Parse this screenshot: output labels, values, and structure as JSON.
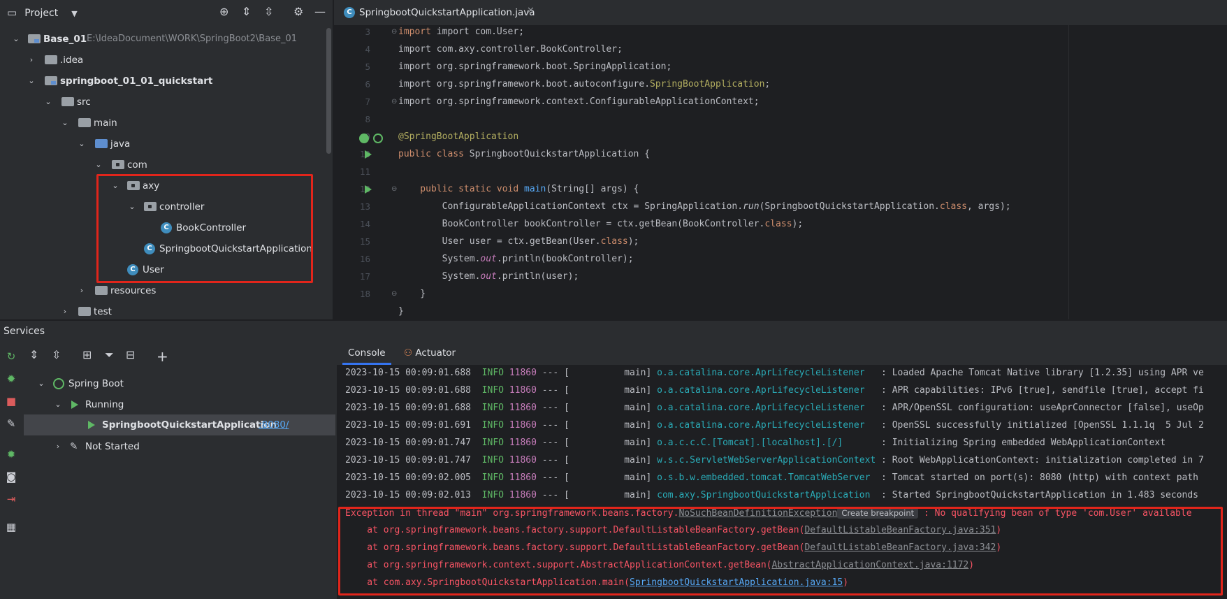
{
  "project": {
    "title": "Project",
    "tree": [
      {
        "label": "Base_01",
        "path": "E:\\IdeaDocument\\WORK\\SpringBoot2\\Base_01"
      },
      {
        "label": ".idea"
      },
      {
        "label": "springboot_01_01_quickstart"
      },
      {
        "label": "src"
      },
      {
        "label": "main"
      },
      {
        "label": "java"
      },
      {
        "label": "com"
      },
      {
        "label": "axy"
      },
      {
        "label": "controller"
      },
      {
        "label": "BookController"
      },
      {
        "label": "SpringbootQuickstartApplication"
      },
      {
        "label": "User"
      },
      {
        "label": "resources"
      },
      {
        "label": "test"
      }
    ]
  },
  "editor": {
    "tab_label": "SpringbootQuickstartApplication.java",
    "line_numbers": [
      "3",
      "4",
      "5",
      "6",
      "7",
      "8",
      "9",
      "10",
      "11",
      "12",
      "13",
      "14",
      "15",
      "16",
      "17",
      "18"
    ],
    "code": {
      "l3": "import com.User;",
      "l4": "import com.axy.controller.BookController;",
      "l5": "import org.springframework.boot.SpringApplication;",
      "l6a": "import org.springframework.boot.autoconfigure.",
      "l6b": "SpringBootApplication",
      "l6c": ";",
      "l7": "import org.springframework.context.ConfigurableApplicationContext;",
      "l9": "@SpringBootApplication",
      "l10a": "public class ",
      "l10b": "SpringbootQuickstartApplication {",
      "l12a": "    public static void ",
      "l12b": "main",
      "l12c": "(String[] args) {",
      "l13a": "        ConfigurableApplicationContext ctx = SpringApplication.",
      "l13b": "run",
      "l13c": "(SpringbootQuickstartApplication.",
      "l13d": "class",
      "l13e": ", args);",
      "l14a": "        BookController bookController = ctx.getBean(BookController.",
      "l14b": "class",
      "l14c": ");",
      "l15a": "        User user = ctx.getBean(User.",
      "l15b": "class",
      "l15c": ");",
      "l16a": "        System.",
      "l16b": "out",
      "l16c": ".println(bookController);",
      "l17a": "        System.",
      "l17b": "out",
      "l17c": ".println(user);",
      "l18": "    }",
      "l19": "}"
    }
  },
  "services": {
    "title": "Services",
    "tree": {
      "spring_boot": "Spring Boot",
      "running": "Running",
      "app": "SpringbootQuickstartApplication",
      "port": ":8080/",
      "not_started": "Not Started"
    },
    "tabs": [
      "Console",
      "Actuator"
    ],
    "logs": [
      {
        "ts": "2023-10-15 00:09:01.688",
        "level": "INFO",
        "pid": "11860",
        "sep": "--- [",
        "thread": "          main]",
        "logger": "o.a.catalina.core.AprLifecycleListener  ",
        "msg": " : Loaded Apache Tomcat Native library [1.2.35] using APR ve"
      },
      {
        "ts": "2023-10-15 00:09:01.688",
        "level": "INFO",
        "pid": "11860",
        "sep": "--- [",
        "thread": "          main]",
        "logger": "o.a.catalina.core.AprLifecycleListener  ",
        "msg": " : APR capabilities: IPv6 [true], sendfile [true], accept fi"
      },
      {
        "ts": "2023-10-15 00:09:01.688",
        "level": "INFO",
        "pid": "11860",
        "sep": "--- [",
        "thread": "          main]",
        "logger": "o.a.catalina.core.AprLifecycleListener  ",
        "msg": " : APR/OpenSSL configuration: useAprConnector [false], useOp"
      },
      {
        "ts": "2023-10-15 00:09:01.691",
        "level": "INFO",
        "pid": "11860",
        "sep": "--- [",
        "thread": "          main]",
        "logger": "o.a.catalina.core.AprLifecycleListener  ",
        "msg": " : OpenSSL successfully initialized [OpenSSL 1.1.1q  5 Jul 2"
      },
      {
        "ts": "2023-10-15 00:09:01.747",
        "level": "INFO",
        "pid": "11860",
        "sep": "--- [",
        "thread": "          main]",
        "logger": "o.a.c.c.C.[Tomcat].[localhost].[/]      ",
        "msg": " : Initializing Spring embedded WebApplicationContext"
      },
      {
        "ts": "2023-10-15 00:09:01.747",
        "level": "INFO",
        "pid": "11860",
        "sep": "--- [",
        "thread": "          main]",
        "logger": "w.s.c.ServletWebServerApplicationContext",
        "msg": " : Root WebApplicationContext: initialization completed in 7"
      },
      {
        "ts": "2023-10-15 00:09:02.005",
        "level": "INFO",
        "pid": "11860",
        "sep": "--- [",
        "thread": "          main]",
        "logger": "o.s.b.w.embedded.tomcat.TomcatWebServer ",
        "msg": " : Tomcat started on port(s): 8080 (http) with context path"
      },
      {
        "ts": "2023-10-15 00:09:02.013",
        "level": "INFO",
        "pid": "11860",
        "sep": "--- [",
        "thread": "          main]",
        "logger": "com.axy.SpringbootQuickstartApplication ",
        "msg": " : Started SpringbootQuickstartApplication in 1.483 seconds"
      }
    ],
    "exception": {
      "prefix": "Exception in thread \"main\" org.springframework.beans.factory.",
      "class": "NoSuchBeanDefinitionException",
      "tooltip": "Create breakpoint",
      "suffix": " : No qualifying bean of type 'com.User' available",
      "stack": [
        {
          "text": "    at org.springframework.beans.factory.support.DefaultListableBeanFactory.getBean(",
          "link": "DefaultListableBeanFactory.java:351",
          "end": ")"
        },
        {
          "text": "    at org.springframework.beans.factory.support.DefaultListableBeanFactory.getBean(",
          "link": "DefaultListableBeanFactory.java:342",
          "end": ")"
        },
        {
          "text": "    at org.springframework.context.support.AbstractApplicationContext.getBean(",
          "link": "AbstractApplicationContext.java:1172",
          "end": ")"
        },
        {
          "text": "    at com.axy.SpringbootQuickstartApplication.main(",
          "link": "SpringbootQuickstartApplication.java:15",
          "end": ")"
        }
      ]
    }
  },
  "colors": {
    "highlight_box": "#e1251b",
    "accent": "#3574f0",
    "run_green": "#5fb865"
  }
}
